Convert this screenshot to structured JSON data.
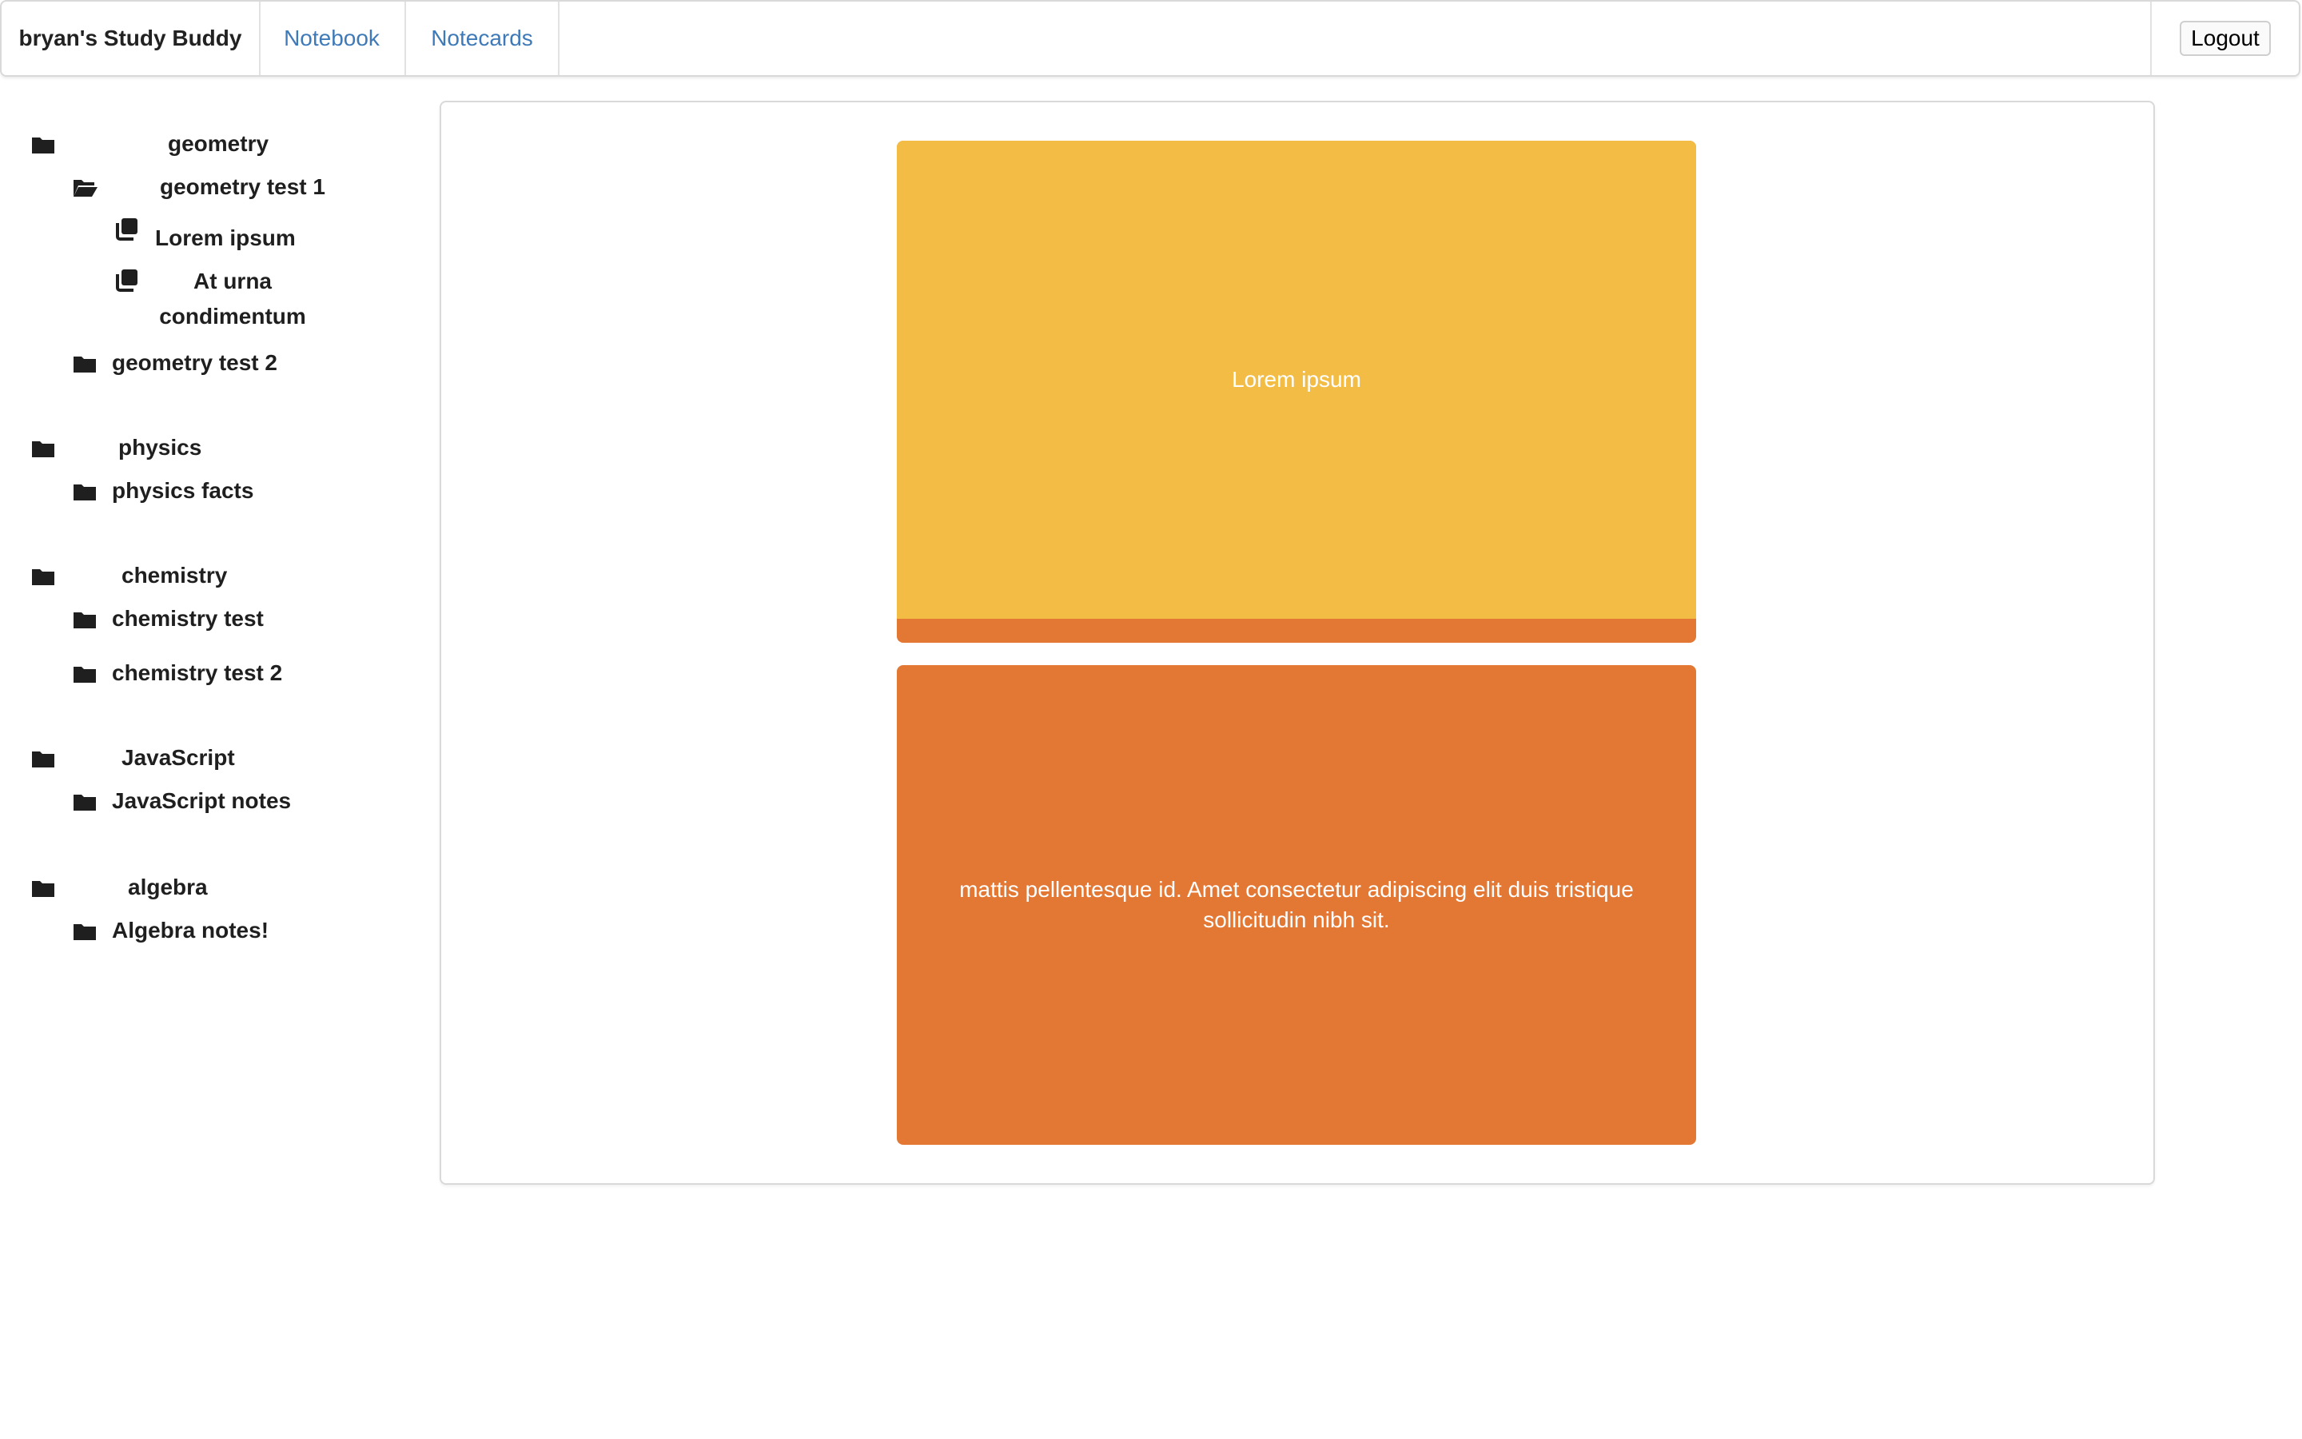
{
  "app": {
    "brand": "bryan's Study Buddy",
    "nav_links": [
      "Notebook",
      "Notecards"
    ],
    "logout_label": "Logout",
    "link_color": "#3f7ab8"
  },
  "tree": {
    "geometry": {
      "label": "geometry",
      "icon": "folder-icon"
    },
    "geometry_test_1": {
      "label": "geometry test 1",
      "icon": "folder-open-icon"
    },
    "lorem_ipsum": {
      "label": "Lorem ipsum",
      "icon": "cards-icon"
    },
    "at_urna": {
      "label": "At urna condimentum",
      "icon": "cards-icon"
    },
    "geometry_test_2": {
      "label": "geometry test 2",
      "icon": "folder-icon"
    },
    "physics": {
      "label": "physics",
      "icon": "folder-icon"
    },
    "physics_facts": {
      "label": "physics facts",
      "icon": "folder-icon"
    },
    "chemistry": {
      "label": "chemistry",
      "icon": "folder-icon"
    },
    "chemistry_test": {
      "label": "chemistry test",
      "icon": "folder-icon"
    },
    "chemistry_test_2": {
      "label": "chemistry test 2",
      "icon": "folder-icon"
    },
    "javascript": {
      "label": "JavaScript",
      "icon": "folder-icon"
    },
    "javascript_notes": {
      "label": "JavaScript notes",
      "icon": "folder-icon"
    },
    "algebra": {
      "label": "algebra",
      "icon": "folder-icon"
    },
    "algebra_notes": {
      "label": "Algebra notes!",
      "icon": "folder-icon"
    }
  },
  "cards": {
    "front_text": "Lorem ipsum",
    "back_text": "mattis pellentesque id. Amet consectetur adipiscing elit duis tristique sollicitudin nibh sit.",
    "front_color": "#f3bd45",
    "back_color": "#e37734"
  }
}
